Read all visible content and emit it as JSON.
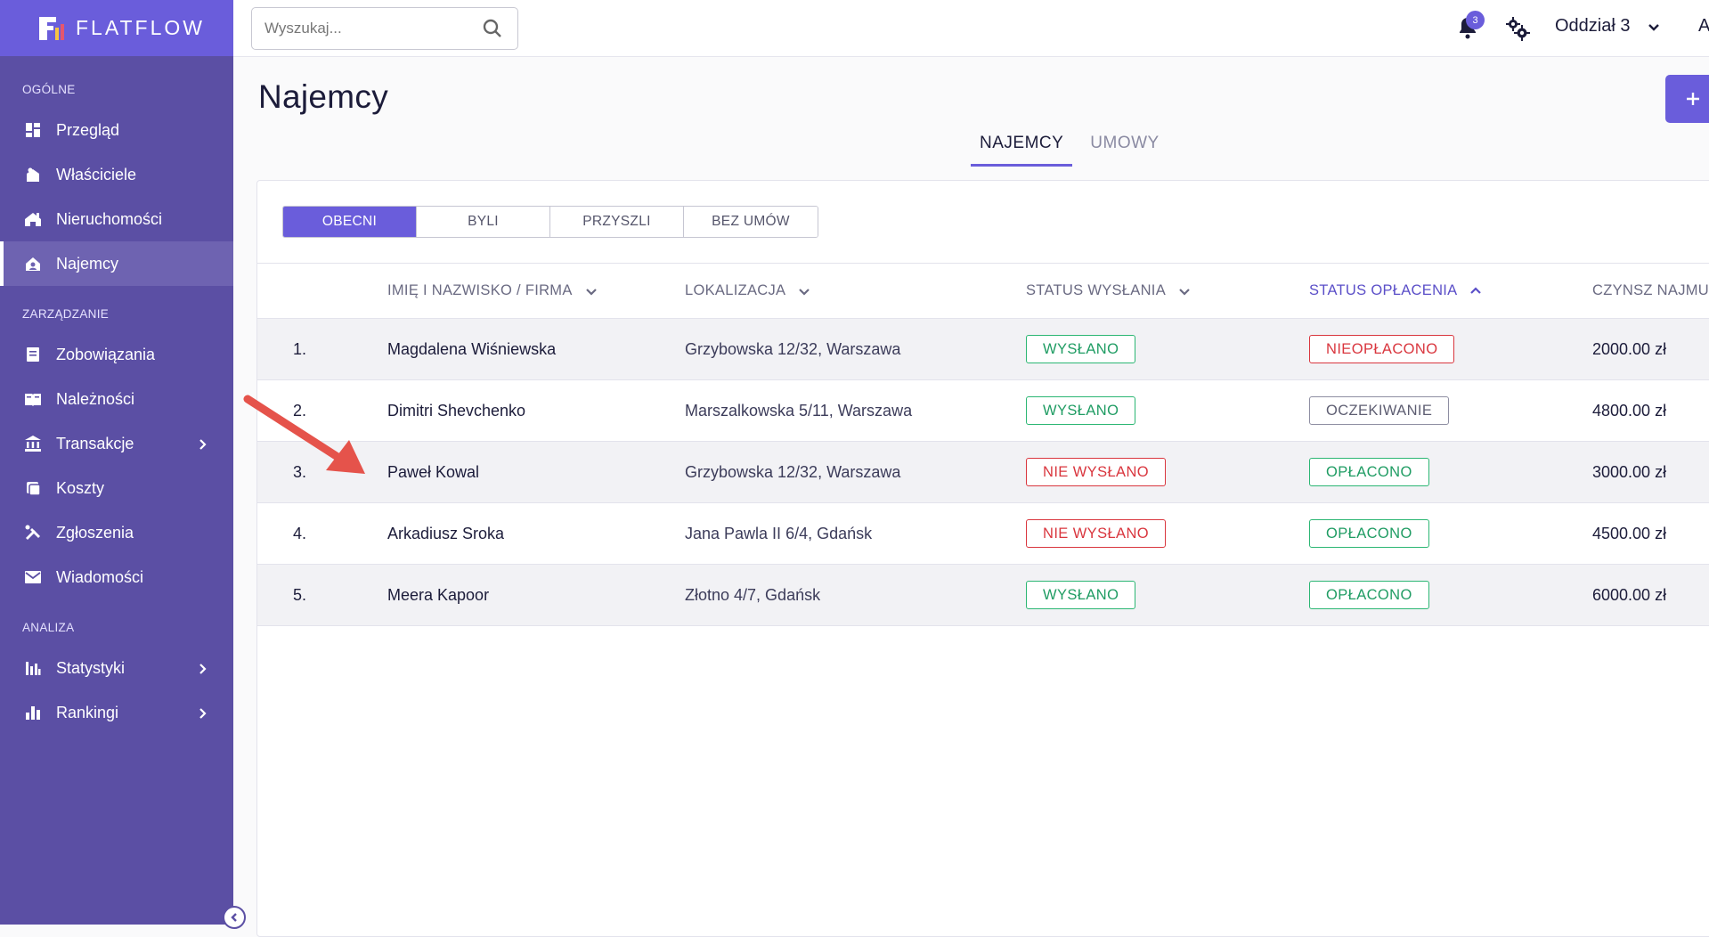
{
  "app": {
    "logo_text": "FLATFLOW"
  },
  "search": {
    "placeholder": "Wyszukaj..."
  },
  "header": {
    "notifications_count": "3",
    "branch": "Oddział 3",
    "user_initial": "A"
  },
  "sidebar": {
    "sections": [
      {
        "title": "OGÓLNE",
        "items": [
          {
            "label": "Przegląd",
            "icon": "dashboard-icon"
          },
          {
            "label": "Właściciele",
            "icon": "owners-icon"
          },
          {
            "label": "Nieruchomości",
            "icon": "property-icon"
          },
          {
            "label": "Najemcy",
            "icon": "tenants-icon",
            "active": true
          }
        ]
      },
      {
        "title": "ZARZĄDZANIE",
        "items": [
          {
            "label": "Zobowiązania",
            "icon": "obligations-icon"
          },
          {
            "label": "Należności",
            "icon": "receivables-icon"
          },
          {
            "label": "Transakcje",
            "icon": "bank-icon",
            "has_submenu": true
          },
          {
            "label": "Koszty",
            "icon": "costs-icon"
          },
          {
            "label": "Zgłoszenia",
            "icon": "tools-icon"
          },
          {
            "label": "Wiadomości",
            "icon": "mail-icon"
          }
        ]
      },
      {
        "title": "ANALIZA",
        "items": [
          {
            "label": "Statystyki",
            "icon": "stats-icon",
            "has_submenu": true
          },
          {
            "label": "Rankingi",
            "icon": "ranking-icon",
            "has_submenu": true
          }
        ]
      }
    ]
  },
  "page": {
    "title": "Najemcy",
    "tabs": [
      "NAJEMCY",
      "UMOWY"
    ],
    "active_tab": 0,
    "filters": [
      "OBECNI",
      "BYLI",
      "PRZYSZLI",
      "BEZ UMÓW"
    ],
    "active_filter": 0
  },
  "table": {
    "columns": [
      "IMIĘ I NAZWISKO / FIRMA",
      "LOKALIZACJA",
      "STATUS WYSŁANIA",
      "STATUS OPŁACENIA",
      "CZYNSZ NAJMU"
    ],
    "sorted_column": 3,
    "rows": [
      {
        "no": "1.",
        "name": "Magdalena Wiśniewska",
        "location": "Grzybowska 12/32, Warszawa",
        "send_status": "WYSŁANO",
        "pay_status": "NIEOPŁACONO",
        "rent": "2000.00 zł"
      },
      {
        "no": "2.",
        "name": "Dimitri Shevchenko",
        "location": "Marszalkowska 5/11, Warszawa",
        "send_status": "WYSŁANO",
        "pay_status": "OCZEKIWANIE",
        "rent": "4800.00 zł"
      },
      {
        "no": "3.",
        "name": "Paweł Kowal",
        "location": "Grzybowska 12/32, Warszawa",
        "send_status": "NIE WYSŁANO",
        "pay_status": "OPŁACONO",
        "rent": "3000.00 zł"
      },
      {
        "no": "4.",
        "name": "Arkadiusz Sroka",
        "location": "Jana Pawla II 6/4, Gdańsk",
        "send_status": "NIE WYSŁANO",
        "pay_status": "OPŁACONO",
        "rent": "4500.00 zł"
      },
      {
        "no": "5.",
        "name": "Meera Kapoor",
        "location": "Złotno 4/7, Gdańsk",
        "send_status": "WYSŁANO",
        "pay_status": "OPŁACONO",
        "rent": "6000.00 zł"
      }
    ]
  },
  "colors": {
    "accent": "#6a5ddb",
    "sidebar": "#5b4fa4",
    "ok": "#2bb673",
    "error": "#d9363e",
    "pending": "#8e8ea2",
    "annotation_arrow": "#e5534b"
  }
}
